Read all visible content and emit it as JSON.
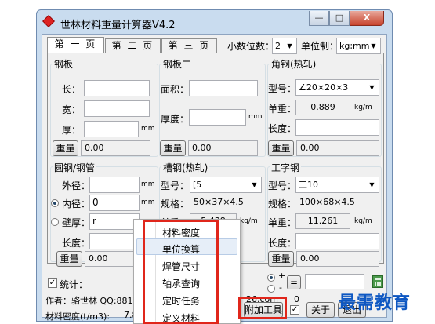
{
  "window": {
    "title": "世林材料重量计算器V4.2",
    "minimize": "—",
    "maximize": "□",
    "close": "X"
  },
  "tabs": [
    "第 一 页",
    "第 二 页",
    "第 三 页"
  ],
  "decimals": {
    "label": "小数位数：",
    "value": "2"
  },
  "unit_system": {
    "label": "单位制：",
    "value": "kg;mm"
  },
  "steel_plate_1": {
    "title": "钢板一",
    "length": "长：",
    "width": "宽：",
    "thickness": "厚：",
    "unit": "mm",
    "button": "重量",
    "result": "0.00"
  },
  "steel_plate_2": {
    "title": "钢板二",
    "area": "面积：",
    "thickness": "厚度：",
    "unit": "mm",
    "button": "重量",
    "result": "0.00"
  },
  "angle_steel": {
    "title": "角钢(热轧)",
    "model_label": "型号：",
    "model_value": "∠20×20×3",
    "unit_weight_label": "单重：",
    "unit_weight_value": "0.889",
    "unit_weight_unit": "kg/m",
    "length_label": "长度：",
    "button": "重量",
    "result": "0.00"
  },
  "round_tube": {
    "title": "圆钢/钢管",
    "outer": "外径：",
    "inner": "内径：",
    "inner_value": "0",
    "wall": "壁厚：",
    "wall_value": "r",
    "length": "长度：",
    "unit": "mm",
    "button": "重量",
    "result": "0.00"
  },
  "channel_steel": {
    "title": "槽钢(热轧)",
    "model_label": "型号：",
    "model_value": "[5",
    "spec_label": "规格：",
    "spec_value": "50×37×4.5",
    "unit_weight_label": "单重：",
    "unit_weight_value": "5.438",
    "unit_weight_unit": "kg/m"
  },
  "i_beam": {
    "title": "工字钢",
    "model_label": "型号：",
    "model_value": "工10",
    "spec_label": "规格：",
    "spec_value": "100×68×4.5",
    "unit_weight_label": "单重：",
    "unit_weight_value": "11.261",
    "unit_weight_unit": "kg/m",
    "length_label": "长度：",
    "button": "重量",
    "result": "0.00"
  },
  "bottom": {
    "stats_label": "统计：",
    "plus": "+",
    "minus": "-",
    "equals": "=",
    "author": "作者：骆世林 QQ:881",
    "url_tail": "26.com",
    "zero": "0",
    "density_label": "材料密度(t/m3):",
    "density_value": "7.8",
    "extra_tools": "附加工具",
    "about": "关于",
    "exit": "退出"
  },
  "context_menu": [
    "材料密度",
    "单位换算",
    "焊管尺寸",
    "轴承查询",
    "定时任务",
    "定义材料"
  ],
  "watermark": "最需教育"
}
